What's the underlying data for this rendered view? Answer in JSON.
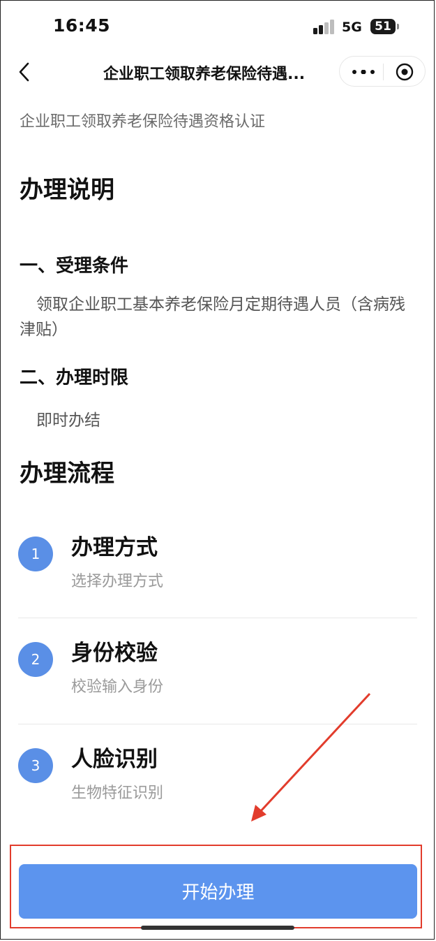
{
  "status": {
    "time": "16:45",
    "network": "5G",
    "battery": "51"
  },
  "nav": {
    "title": "企业职工领取养老保险待遇..."
  },
  "page": {
    "subtitle": "企业职工领取养老保险待遇资格认证",
    "intro_heading": "办理说明",
    "section1_title": "一、受理条件",
    "section1_text": "领取企业职工基本养老保险月定期待遇人员（含病残津贴）",
    "section2_title": "二、办理时限",
    "section2_text": "即时办结",
    "flow_heading": "办理流程"
  },
  "steps": [
    {
      "num": "1",
      "title": "办理方式",
      "desc": "选择办理方式"
    },
    {
      "num": "2",
      "title": "身份校验",
      "desc": "校验输入身份"
    },
    {
      "num": "3",
      "title": "人脸识别",
      "desc": "生物特征识别"
    }
  ],
  "cta": {
    "label": "开始办理"
  },
  "colors": {
    "accent": "#5c94ee",
    "step_circle": "#5a8fe6",
    "annotation": "#e23c2c"
  }
}
